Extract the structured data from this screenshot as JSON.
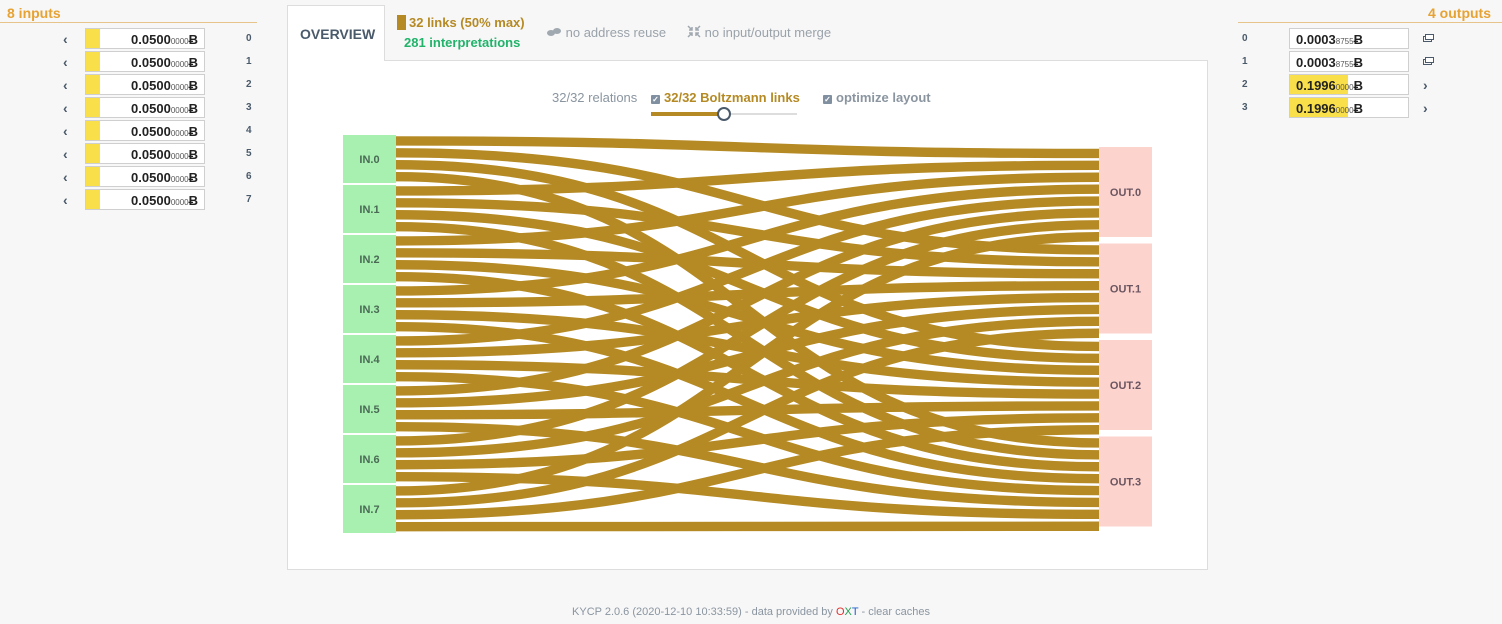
{
  "inputs": {
    "title": "8 inputs",
    "items": [
      {
        "index": "0",
        "amount": "0.0500",
        "small": "0000",
        "unit": "Ƀ"
      },
      {
        "index": "1",
        "amount": "0.0500",
        "small": "0000",
        "unit": "Ƀ"
      },
      {
        "index": "2",
        "amount": "0.0500",
        "small": "0000",
        "unit": "Ƀ"
      },
      {
        "index": "3",
        "amount": "0.0500",
        "small": "0000",
        "unit": "Ƀ"
      },
      {
        "index": "4",
        "amount": "0.0500",
        "small": "0000",
        "unit": "Ƀ"
      },
      {
        "index": "5",
        "amount": "0.0500",
        "small": "0000",
        "unit": "Ƀ"
      },
      {
        "index": "6",
        "amount": "0.0500",
        "small": "0000",
        "unit": "Ƀ"
      },
      {
        "index": "7",
        "amount": "0.0500",
        "small": "0000",
        "unit": "Ƀ"
      }
    ]
  },
  "outputs": {
    "title": "4 outputs",
    "items": [
      {
        "index": "0",
        "amount": "0.0003",
        "small": "8755",
        "unit": "Ƀ",
        "highlight": false,
        "icon": "stack-icon"
      },
      {
        "index": "1",
        "amount": "0.0003",
        "small": "8755",
        "unit": "Ƀ",
        "highlight": false,
        "icon": "stack-icon"
      },
      {
        "index": "2",
        "amount": "0.1996",
        "small": "0000",
        "unit": "Ƀ",
        "highlight": true,
        "icon": "chevron-right-icon"
      },
      {
        "index": "3",
        "amount": "0.1996",
        "small": "0000",
        "unit": "Ƀ",
        "highlight": true,
        "icon": "chevron-right-icon"
      }
    ]
  },
  "tabs": {
    "overview": "OVERVIEW"
  },
  "summary": {
    "links": "32 links (50% max)",
    "interpretations": "281 interpretations",
    "address_reuse": "no address reuse",
    "io_merge": "no input/output merge"
  },
  "controls": {
    "relations": "32/32 relations",
    "boltzmann": "32/32 Boltzmann links",
    "optimize": "optimize layout",
    "slider_value": 0.5
  },
  "diagram": {
    "input_labels": [
      "IN.0",
      "IN.1",
      "IN.2",
      "IN.3",
      "IN.4",
      "IN.5",
      "IN.6",
      "IN.7"
    ],
    "output_labels": [
      "OUT.0",
      "OUT.1",
      "OUT.2",
      "OUT.3"
    ],
    "link_count": 32
  },
  "footer": {
    "version": "KYCP 2.0.6 (2020-12-10 10:33:59) - data provided by ",
    "brand_o": "O",
    "brand_x": "X",
    "brand_t": "T",
    "sep": " - ",
    "clear": "clear caches"
  },
  "colors": {
    "link": "#b58a24",
    "input_node": "#a8f0b0",
    "output_node": "#fdd3cd",
    "accent_orange": "#e6a233",
    "green_text": "#22b36b",
    "highlight": "#f9e04a"
  }
}
